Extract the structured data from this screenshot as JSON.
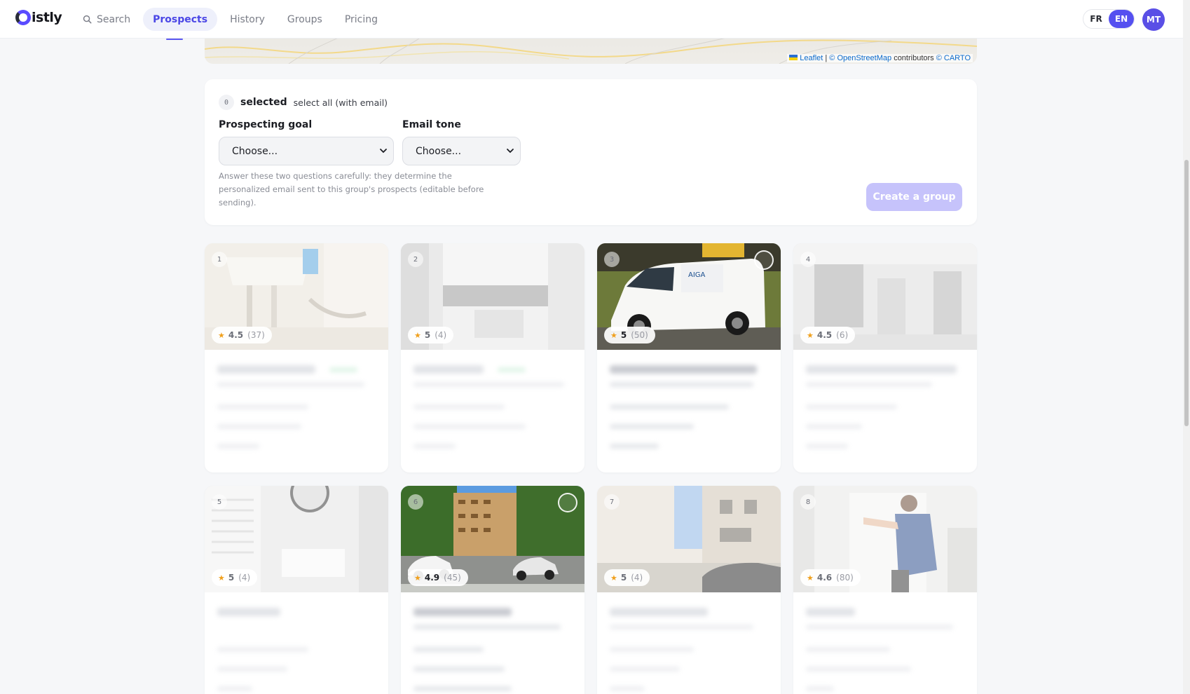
{
  "brand": {
    "name": "istly"
  },
  "nav": {
    "items": [
      {
        "label": "Search",
        "icon": "search-icon"
      },
      {
        "label": "Prospects",
        "active": true
      },
      {
        "label": "History"
      },
      {
        "label": "Groups"
      },
      {
        "label": "Pricing"
      }
    ]
  },
  "lang": {
    "fr": "FR",
    "en": "EN",
    "active": "EN"
  },
  "user": {
    "initials": "MT"
  },
  "map": {
    "attribution": {
      "leaflet": "Leaflet",
      "sep": "|",
      "osm": "© OpenStreetMap",
      "contributors": "contributors",
      "carto": "© CARTO"
    }
  },
  "group": {
    "selected_count": "0",
    "selected_label": "selected",
    "select_all": "select all (with email)",
    "goal_label": "Prospecting goal",
    "goal_value": "Choose...",
    "tone_label": "Email tone",
    "tone_value": "Choose...",
    "hint": "Answer these two questions carefully: they determine the personalized email sent to this group's prospects (editable before sending).",
    "create_button": "Create a group"
  },
  "cards": [
    {
      "num": "1",
      "score": "4.5",
      "count": "(37)",
      "muted": true,
      "selectable": false
    },
    {
      "num": "2",
      "score": "5",
      "count": "(4)",
      "muted": true,
      "selectable": false
    },
    {
      "num": "3",
      "score": "5",
      "count": "(50)",
      "muted": false,
      "selectable": true
    },
    {
      "num": "4",
      "score": "4.5",
      "count": "(6)",
      "muted": true,
      "selectable": false
    },
    {
      "num": "5",
      "score": "5",
      "count": "(4)",
      "muted": true,
      "selectable": false
    },
    {
      "num": "6",
      "score": "4.9",
      "count": "(45)",
      "muted": false,
      "selectable": true
    },
    {
      "num": "7",
      "score": "5",
      "count": "(4)",
      "muted": true,
      "selectable": false
    },
    {
      "num": "8",
      "score": "4.6",
      "count": "(80)",
      "muted": true,
      "selectable": false
    }
  ],
  "colors": {
    "accent": "#5550f0",
    "star": "#f0a01d",
    "create_disabled": "#c6c3fb"
  }
}
